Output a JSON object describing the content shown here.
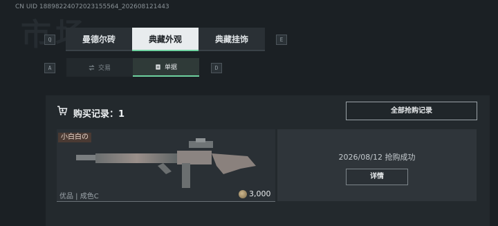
{
  "header": {
    "uid_text": "CN UID 18898224072023155564_202608121443",
    "watermark": "市场"
  },
  "keys": {
    "q": "Q",
    "e": "E",
    "a": "A",
    "d": "D"
  },
  "top_tabs": [
    {
      "label": "曼德尔砖"
    },
    {
      "label": "典藏外观",
      "active": true
    },
    {
      "label": "典藏挂饰"
    }
  ],
  "sub_tabs": [
    {
      "label": "交易",
      "icon": "trade-icon"
    },
    {
      "label": "单据",
      "icon": "receipt-icon",
      "active": true
    }
  ],
  "records": {
    "title": "购买记录：1",
    "all_button": "全部抢购记录",
    "item": {
      "owner": "小白白の",
      "quality": "优品 | 成色C",
      "price": "3,000",
      "status": "2026/08/12 抢购成功",
      "detail_button": "详情"
    }
  },
  "colors": {
    "accent": "#6fd3a0",
    "background": "#1b2024",
    "panel": "#23292d"
  }
}
